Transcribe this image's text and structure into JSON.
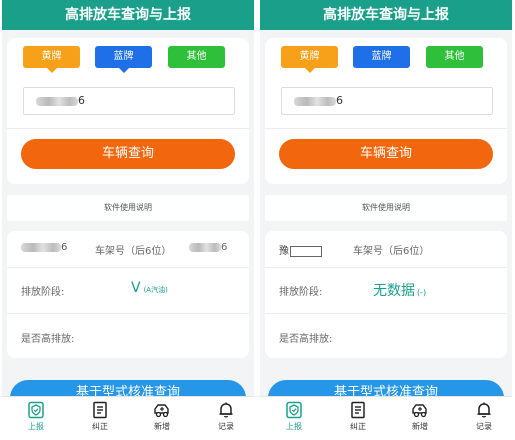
{
  "screens": [
    {
      "title": "高排放车查询与上报",
      "plate_tabs": [
        "黄牌",
        "蓝牌",
        "其他"
      ],
      "plate_input_suffix": "6",
      "query_button": "车辆查询",
      "help_link": "软件使用说明",
      "plate_display_suffix": "6",
      "vin_label": "车架号（后6位）",
      "vin_value_suffix": "6",
      "stage_label": "排放阶段:",
      "stage_value": "V",
      "stage_sub": "(A汽油)",
      "high_emission_label": "是否高排放:",
      "bottom_button": "基于型式核准查询",
      "nav": [
        "上报",
        "纠正",
        "新增",
        "记录"
      ]
    },
    {
      "title": "高排放车查询与上报",
      "plate_tabs": [
        "黄牌",
        "蓝牌",
        "其他"
      ],
      "plate_input_suffix": "6",
      "query_button": "车辆查询",
      "help_link": "软件使用说明",
      "plate_display_prefix": "豫",
      "vin_label": "车架号（后6位）",
      "stage_label": "排放阶段:",
      "stage_value": "无数据",
      "stage_sub": "(-)",
      "high_emission_label": "是否高排放:",
      "bottom_button": "基于型式核准查询",
      "nav": [
        "上报",
        "纠正",
        "新增",
        "记录"
      ]
    }
  ],
  "colors": {
    "header": "#1aa08a",
    "yellow_plate": "#f7a11a",
    "blue_plate": "#1e6fe8",
    "other_plate": "#2fbf3a",
    "query_button": "#f2670e",
    "bottom_button": "#2596e8"
  },
  "icons": [
    "report-icon",
    "correct-icon",
    "add-vehicle-icon",
    "records-bell-icon"
  ]
}
